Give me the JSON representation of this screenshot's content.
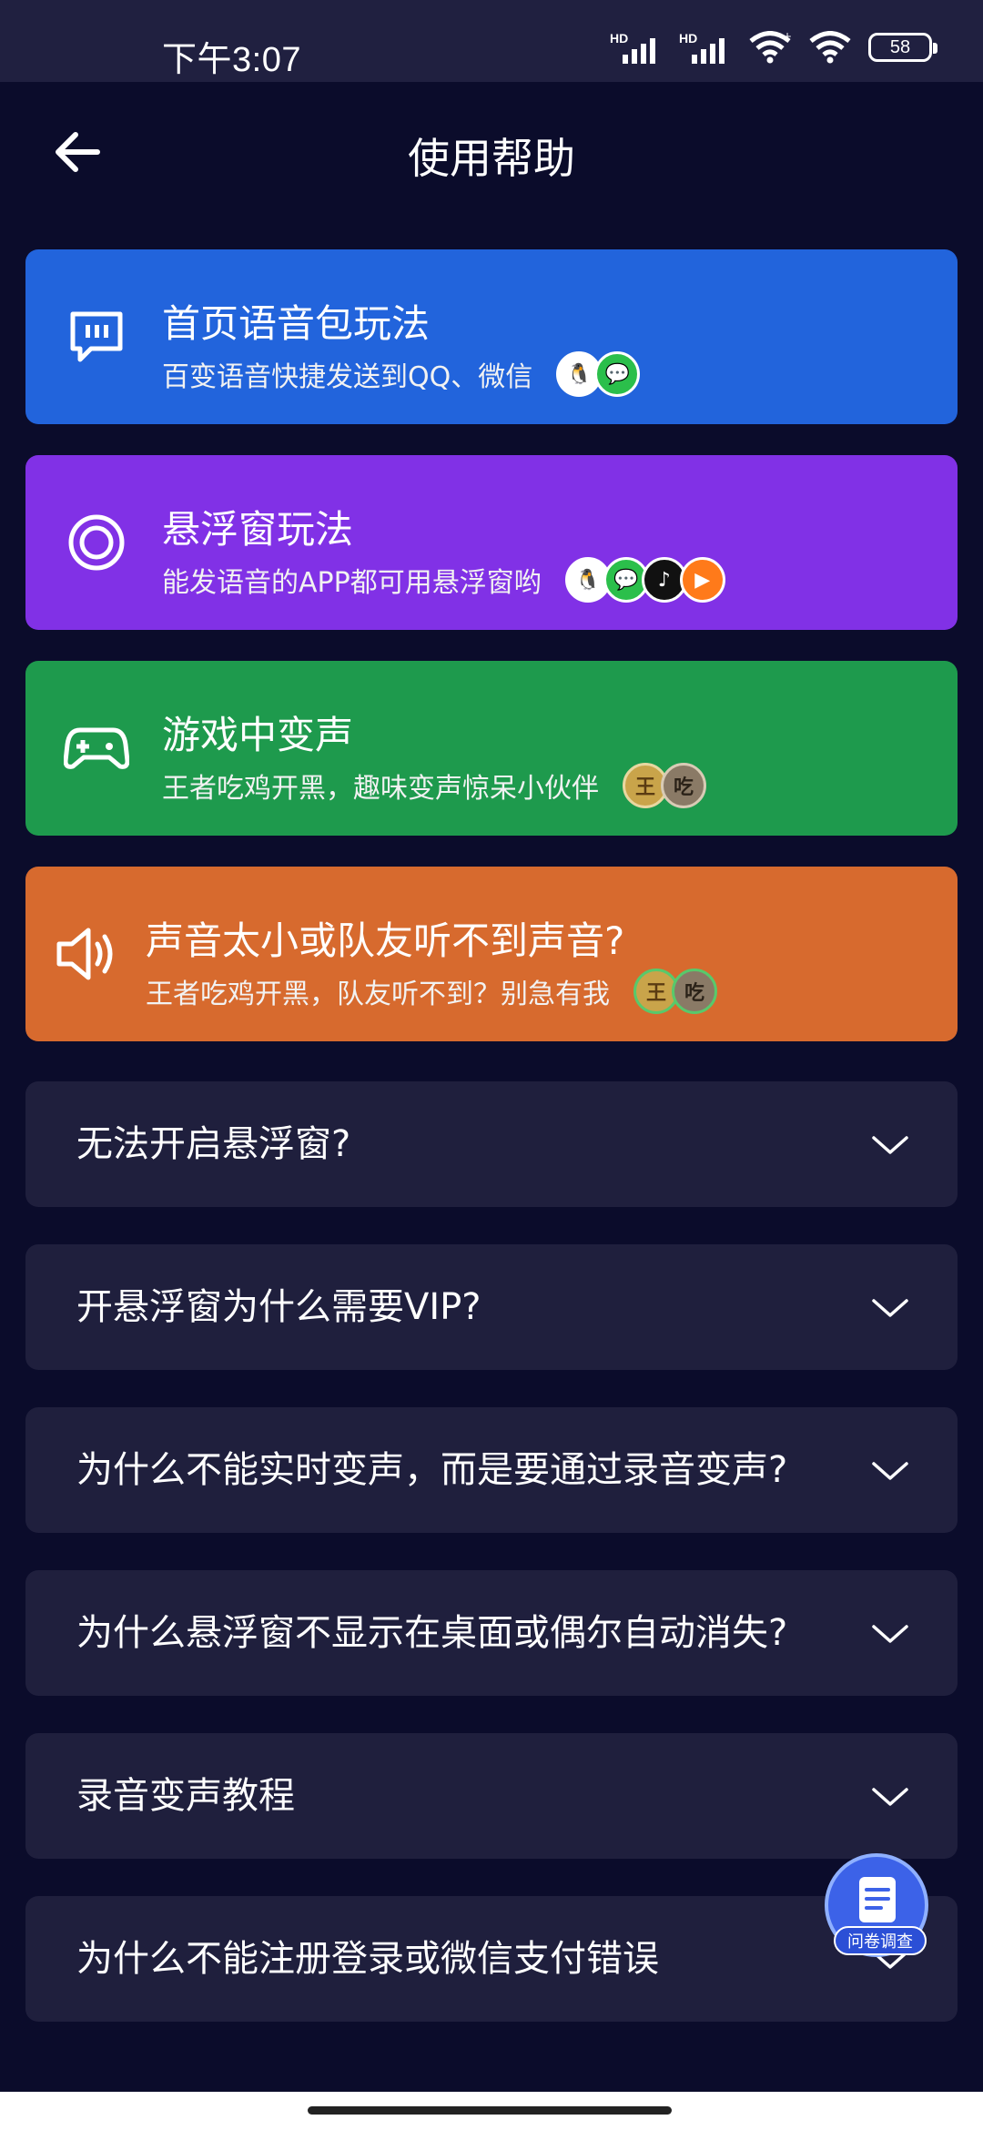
{
  "status_bar": {
    "time": "下午3:07",
    "battery": "58",
    "sim1_tag": "HD",
    "sim2_tag": "HD"
  },
  "header": {
    "title": "使用帮助"
  },
  "cards": [
    {
      "title": "首页语音包玩法",
      "subtitle": "百变语音快捷发送到QQ、微信",
      "color": "#2264dc",
      "icon": "chat-bubble-icon",
      "apps": [
        "qq",
        "wechat"
      ]
    },
    {
      "title": "悬浮窗玩法",
      "subtitle": "能发语音的APP都可用悬浮窗哟",
      "color": "#8131e6",
      "icon": "floating-window-icon",
      "apps": [
        "qq",
        "wechat",
        "douyin",
        "kuaishou"
      ]
    },
    {
      "title": "游戏中变声",
      "subtitle": "王者吃鸡开黑，趣味变声惊呆小伙伴",
      "color": "#1e9a4d",
      "icon": "gamepad-icon",
      "apps": [
        "honor-of-kings",
        "pubg"
      ]
    },
    {
      "title": "声音太小或队友听不到声音?",
      "subtitle": "王者吃鸡开黑，队友听不到？别急有我",
      "color": "#d76a2e",
      "icon": "speaker-icon",
      "apps": [
        "honor-of-kings",
        "pubg"
      ]
    }
  ],
  "faqs": [
    {
      "question": "无法开启悬浮窗?"
    },
    {
      "question": "开悬浮窗为什么需要VIP?"
    },
    {
      "question": "为什么不能实时变声，而是要通过录音变声?"
    },
    {
      "question": "为什么悬浮窗不显示在桌面或偶尔自动消失?"
    },
    {
      "question": "录音变声教程"
    },
    {
      "question": "为什么不能注册登录或微信支付错误"
    }
  ],
  "survey": {
    "label": "问卷调查"
  }
}
